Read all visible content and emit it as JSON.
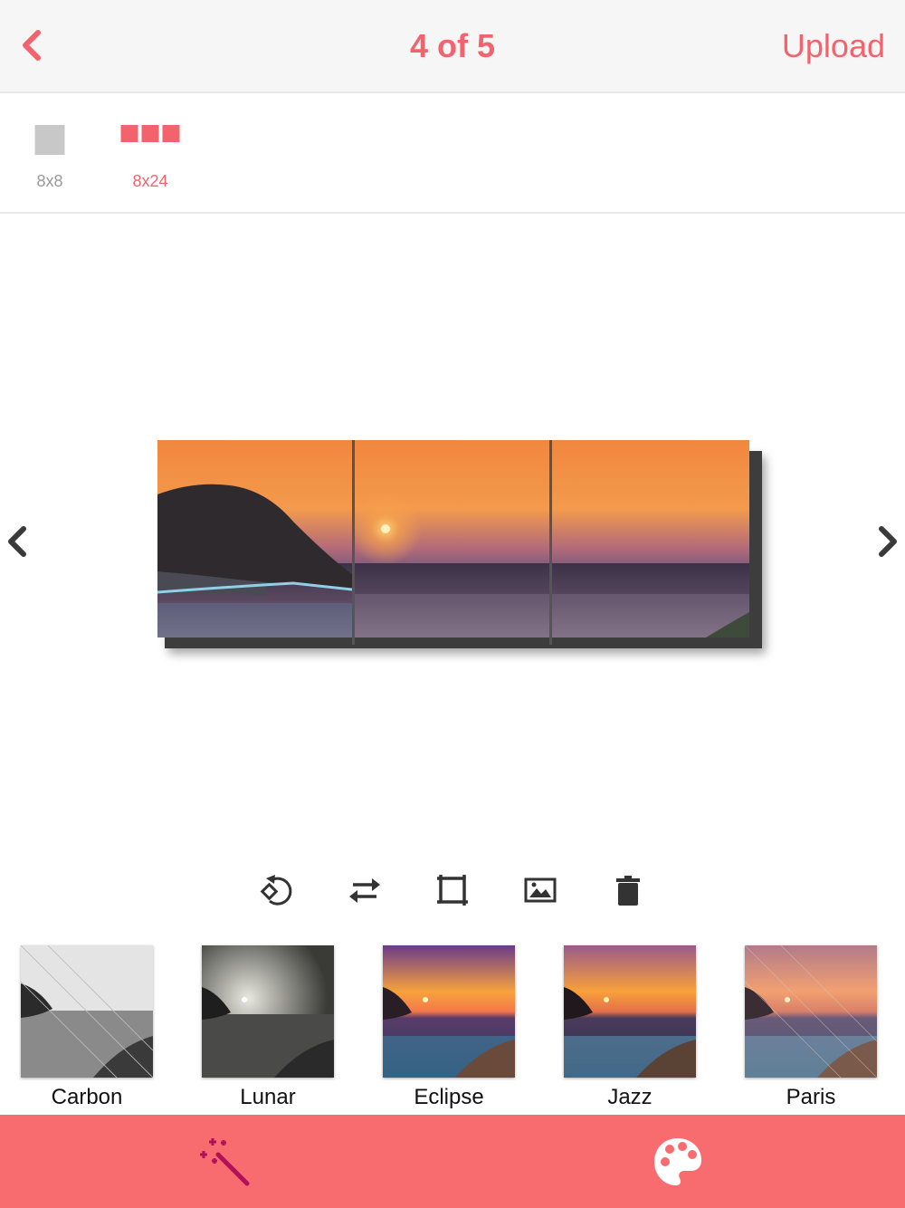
{
  "header": {
    "title": "4 of 5",
    "upload_label": "Upload"
  },
  "sizes": [
    {
      "label": "8x8",
      "active": false
    },
    {
      "label": "8x24",
      "active": true
    }
  ],
  "tools": [
    "rotate-icon",
    "flip-icon",
    "crop-icon",
    "image-icon",
    "trash-icon"
  ],
  "filters": [
    {
      "label": "Carbon"
    },
    {
      "label": "Lunar"
    },
    {
      "label": "Eclipse"
    },
    {
      "label": "Jazz"
    },
    {
      "label": "Paris"
    }
  ],
  "colors": {
    "accent": "#f2636d",
    "bottom_bar": "#f86c70",
    "magic_wand_active": "#b0115a"
  }
}
